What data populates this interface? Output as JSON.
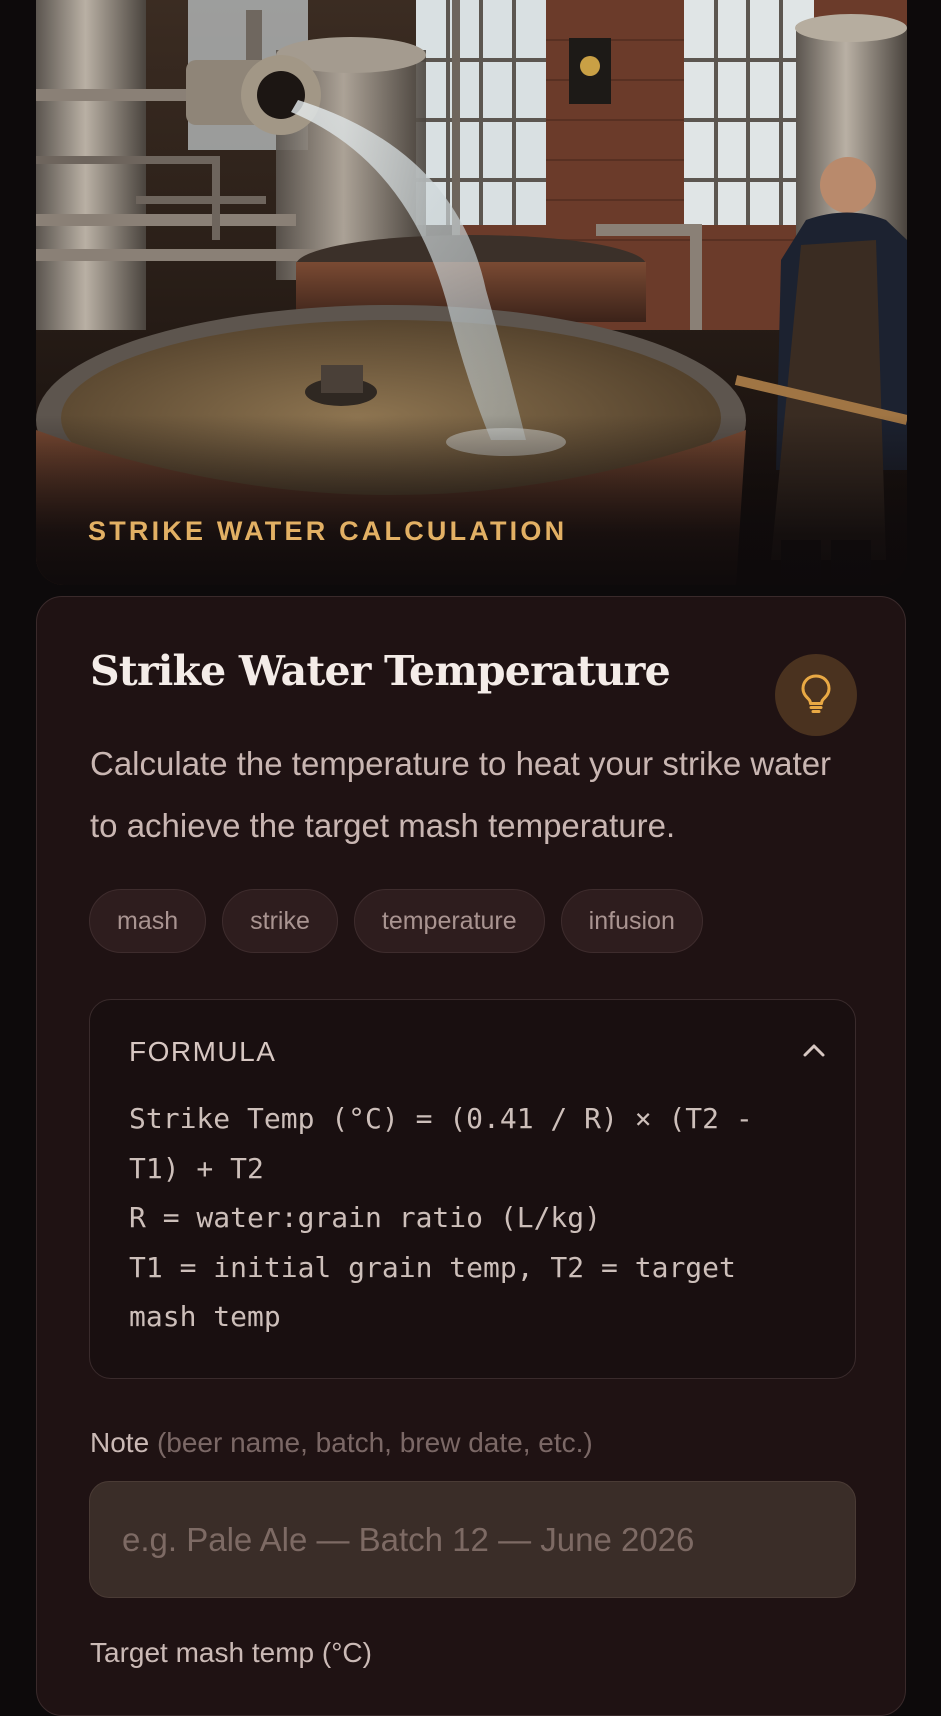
{
  "hero": {
    "kicker": "STRIKE WATER CALCULATION",
    "image_icon": "brewery-mash-tun-photo"
  },
  "card": {
    "title": "Strike Water Temperature",
    "tip_icon": "lightbulb-icon",
    "description": "Calculate the temperature to heat your strike water to achieve the target mash temperature.",
    "tags": [
      "mash",
      "strike",
      "temperature",
      "infusion"
    ]
  },
  "formula": {
    "label": "FORMULA",
    "toggle_icon": "chevron-up-icon",
    "lines": [
      "Strike Temp (°C) = (0.41 / R) × (T2 - T1) + T2",
      "R = water:grain ratio (L/kg)",
      "T1 = initial grain temp, T2 = target mash temp"
    ]
  },
  "note": {
    "label": "Note",
    "hint": "(beer name, batch, brew date, etc.)",
    "placeholder": "e.g. Pale Ale — Batch 12 — June 2026",
    "value": ""
  },
  "target": {
    "label": "Target mash temp (°C)"
  },
  "colors": {
    "accent": "#e2b064",
    "card_bg": "#1f1213",
    "page_bg": "#0d0a0b"
  }
}
